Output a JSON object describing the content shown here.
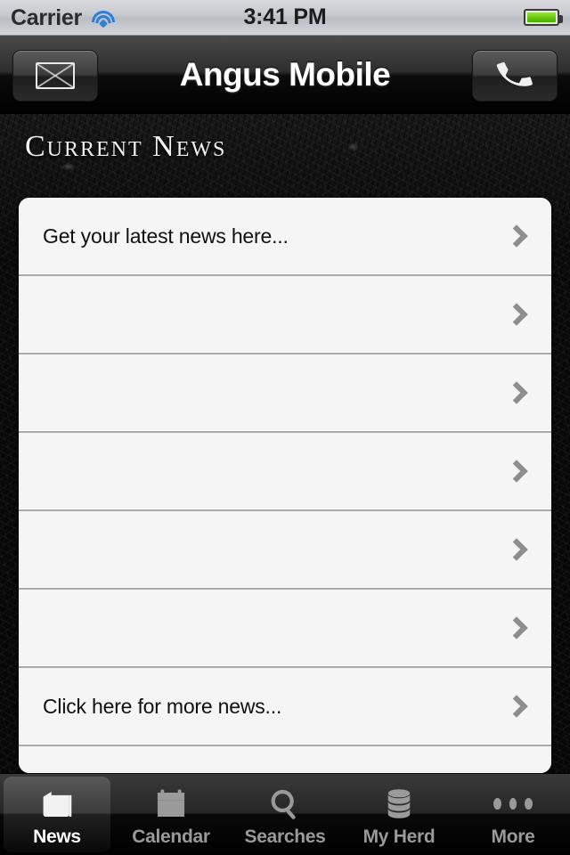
{
  "status_bar": {
    "carrier": "Carrier",
    "time": "3:41 PM",
    "wifi_icon": "wifi-icon",
    "battery_icon": "battery-full-icon",
    "wifi_color": "#2b7fd8",
    "battery_color": "#63c70d"
  },
  "nav_bar": {
    "title": "Angus Mobile",
    "left_button": {
      "name": "mail-button",
      "icon": "envelope-icon"
    },
    "right_button": {
      "name": "phone-button",
      "icon": "phone-handset-icon"
    }
  },
  "section": {
    "title": "Current News"
  },
  "news_list": {
    "rows": [
      {
        "label": "Get your latest news here...",
        "accessory": "chevron-right-icon"
      },
      {
        "label": "",
        "accessory": "chevron-right-icon"
      },
      {
        "label": "",
        "accessory": "chevron-right-icon"
      },
      {
        "label": "",
        "accessory": "chevron-right-icon"
      },
      {
        "label": "",
        "accessory": "chevron-right-icon"
      },
      {
        "label": "",
        "accessory": "chevron-right-icon"
      },
      {
        "label": "Click here for more news...",
        "accessory": "chevron-right-icon"
      },
      {
        "label": "",
        "accessory": ""
      }
    ]
  },
  "tab_bar": {
    "selected_index": 0,
    "tabs": [
      {
        "label": "News",
        "icon": "newspaper-icon"
      },
      {
        "label": "Calendar",
        "icon": "calendar-icon"
      },
      {
        "label": "Searches",
        "icon": "magnifier-icon"
      },
      {
        "label": "My Herd",
        "icon": "database-icon"
      },
      {
        "label": "More",
        "icon": "three-dots-icon"
      }
    ]
  }
}
